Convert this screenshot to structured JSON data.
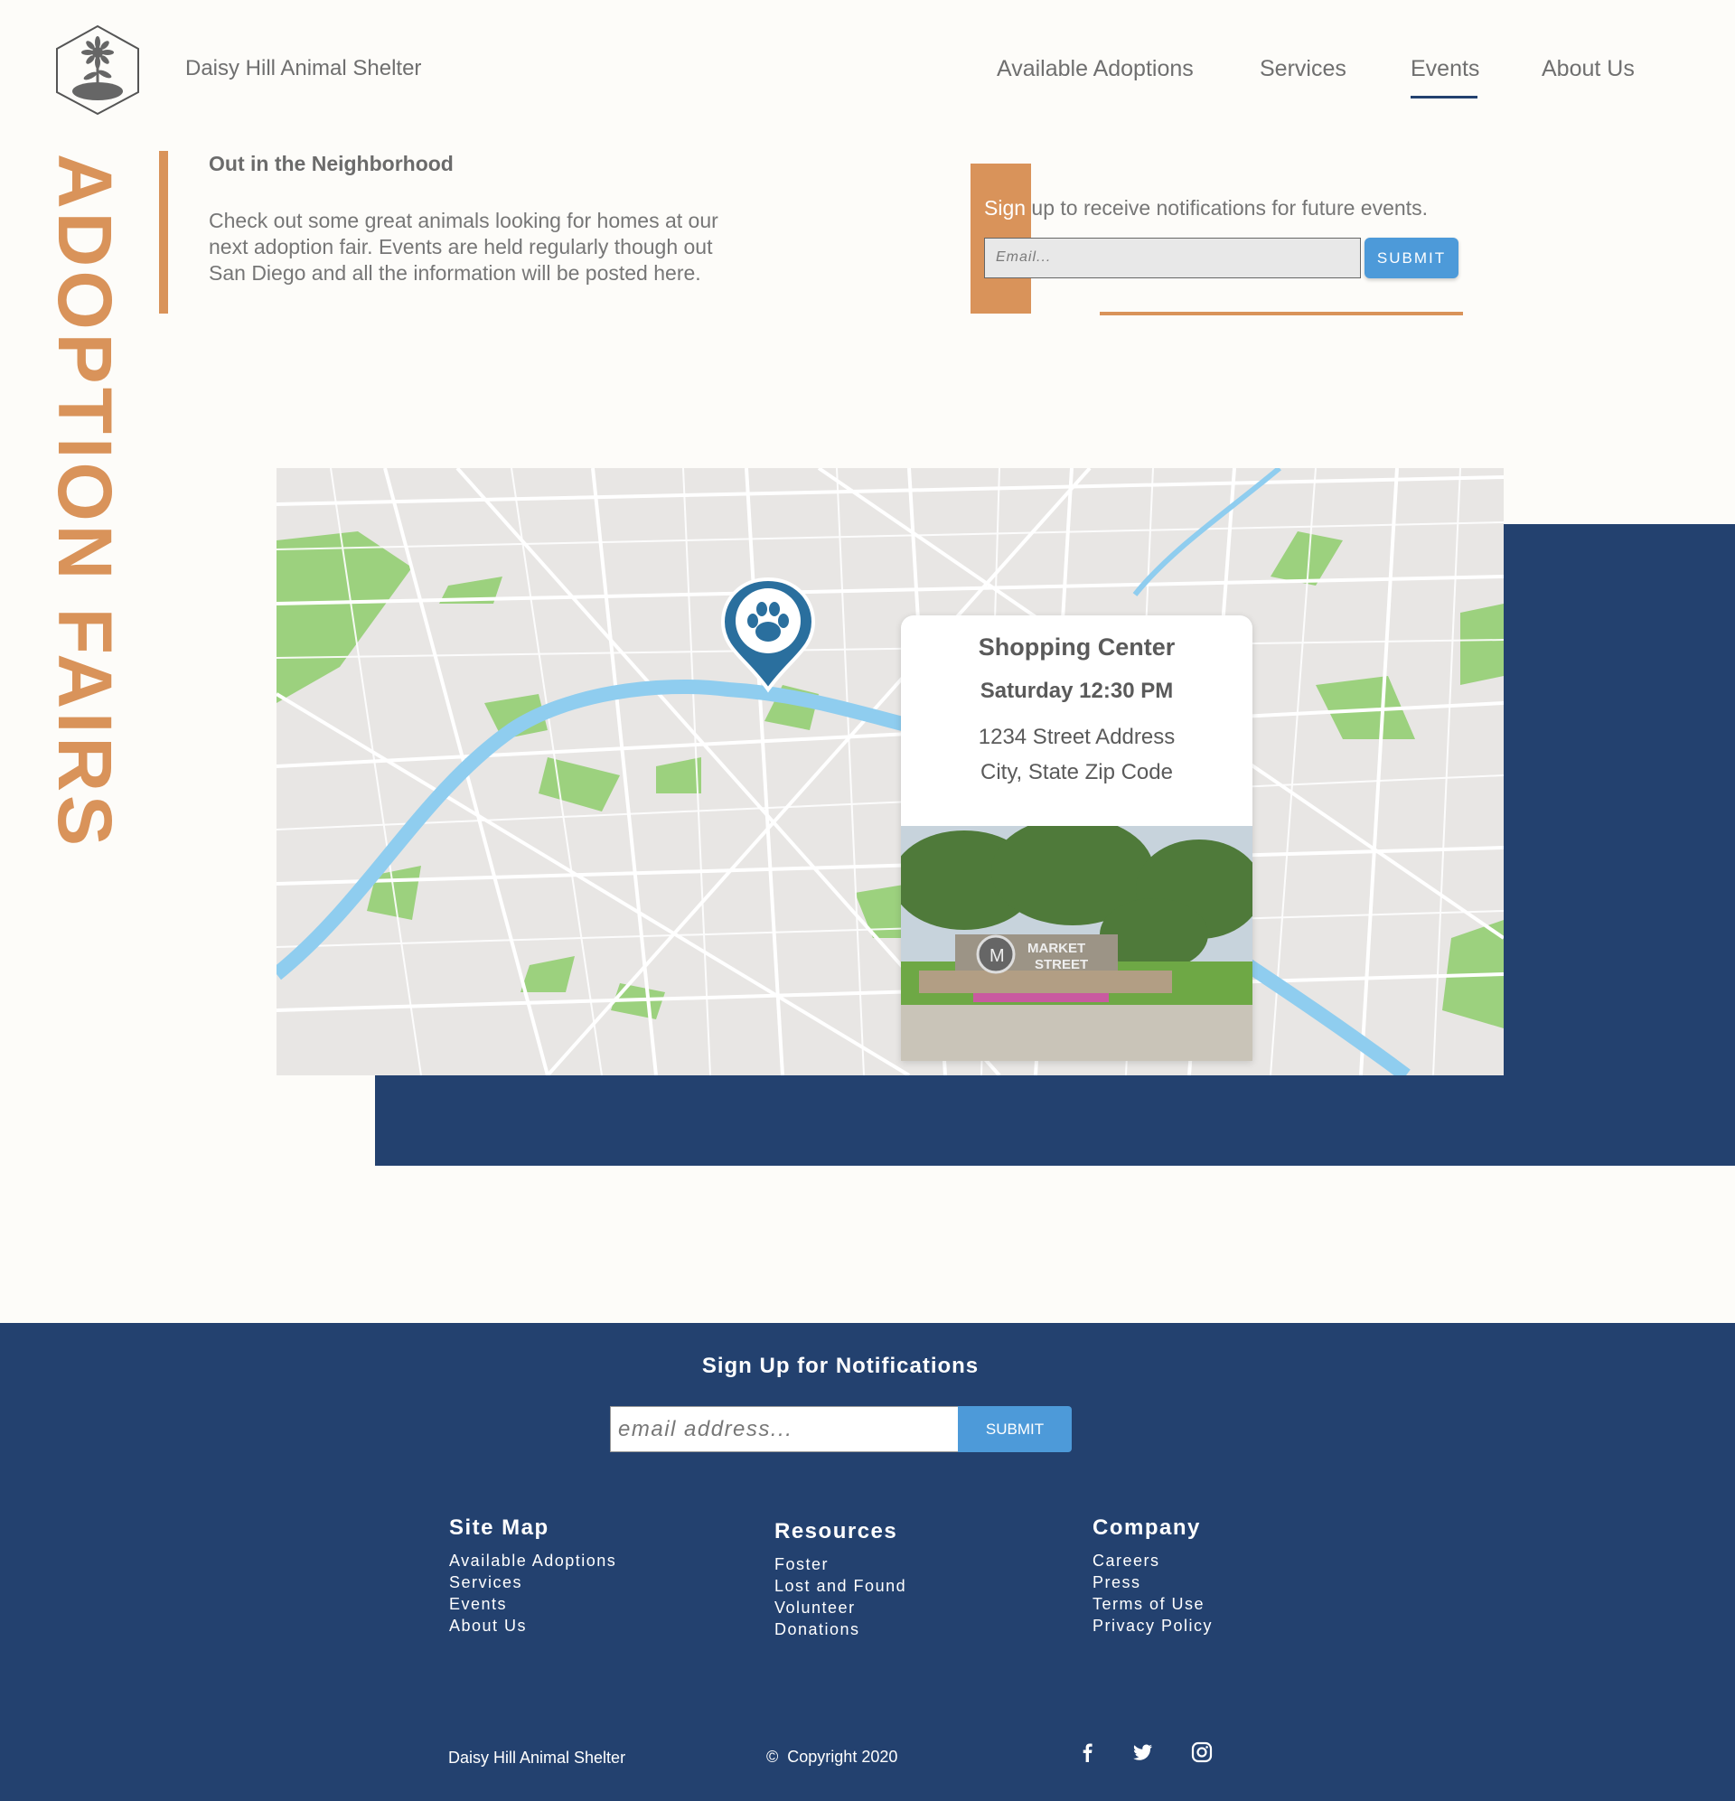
{
  "header": {
    "brand": "Daisy Hill Animal Shelter",
    "nav": [
      {
        "label": "Available Adoptions"
      },
      {
        "label": "Services"
      },
      {
        "label": "Events",
        "active": true
      },
      {
        "label": "About Us"
      }
    ]
  },
  "hero": {
    "vertical_title": "ADOPTION FAIRS",
    "intro_title": "Out in the Neighborhood",
    "intro_text": "Check out some great animals looking for homes at our next adoption fair. Events are held regularly though out San Diego and all the information will be posted here."
  },
  "signup": {
    "text_first": "Sign",
    "text_rest": " up to receive notifications for future events.",
    "email_placeholder": "Email...",
    "submit_label": "SUBMIT"
  },
  "event_card": {
    "title": "Shopping Center",
    "time": "Saturday 12:30 PM",
    "address_line1": "1234 Street Address",
    "address_line2": "City, State Zip Code",
    "photo_sign_line1": "MARKET",
    "photo_sign_line2": "STREET"
  },
  "footer": {
    "signup_title": "Sign Up for Notifications",
    "email_placeholder": "email address...",
    "submit_label": "SUBMIT",
    "columns": [
      {
        "heading": "Site Map",
        "items": [
          "Available Adoptions",
          "Services",
          "Events",
          "About Us"
        ]
      },
      {
        "heading": "Resources",
        "items": [
          "Foster",
          "Lost and Found",
          "Volunteer",
          "Donations"
        ]
      },
      {
        "heading": "Company",
        "items": [
          "Careers",
          "Press",
          "Terms of Use",
          "Privacy Policy"
        ]
      }
    ],
    "brand": "Daisy Hill Animal Shelter",
    "copyright": "Copyright 2020",
    "social_icons": [
      "facebook-icon",
      "twitter-icon",
      "instagram-icon"
    ]
  },
  "colors": {
    "accent_orange": "#d9935a",
    "navy": "#23416f",
    "button_blue": "#4d9ad9",
    "background": "#fdfcf9"
  }
}
